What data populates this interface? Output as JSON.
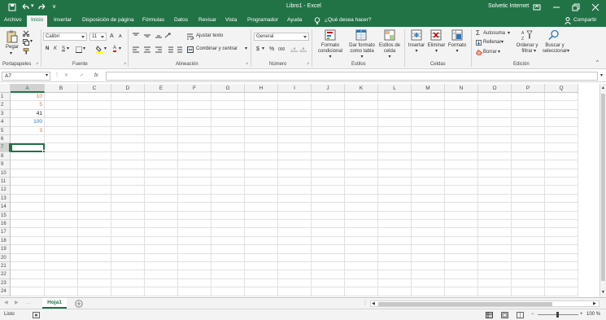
{
  "window": {
    "title": "Libro1 - Excel",
    "user": "Solvetic Internet"
  },
  "quick_access": {
    "customize_label": "∨"
  },
  "tabs": [
    "Archivo",
    "Inicio",
    "Insertar",
    "Disposición de página",
    "Fórmulas",
    "Datos",
    "Revisar",
    "Vista",
    "Programador",
    "Ayuda"
  ],
  "tell_me": "¿Qué desea hacer?",
  "share": "Compartir",
  "ribbon": {
    "portapapeles": {
      "group": "Portapapeles",
      "paste": "Pegar"
    },
    "fuente": {
      "group": "Fuente",
      "font_name": "Calibri",
      "font_size": "11",
      "bold": "N",
      "italic": "K",
      "underline": "S",
      "font_color_letter": "A",
      "grow_letter": "A",
      "shrink_letter": "A"
    },
    "alineacion": {
      "group": "Alineación",
      "wrap": "Ajustar texto",
      "merge": "Combinar y centrar"
    },
    "numero": {
      "group": "Número",
      "format": "General",
      "currency": "$",
      "percent": "%",
      "thousands": "000"
    },
    "estilos": {
      "group": "Estilos",
      "cond_1": "Formato",
      "cond_2": "condicional",
      "table_1": "Dar formato",
      "table_2": "como tabla",
      "cell_1": "Estilos de",
      "cell_2": "celda"
    },
    "celdas": {
      "group": "Celdas",
      "insert": "Insertar",
      "delete": "Eliminar",
      "format": "Formato"
    },
    "edicion": {
      "group": "Edición",
      "autosum": "Autosuma",
      "fill": "Rellenar",
      "clear": "Borrar",
      "sort_1": "Ordenar y",
      "sort_2": "filtrar",
      "find_1": "Buscar y",
      "find_2": "seleccionar"
    }
  },
  "formula_bar": {
    "name_box": "A7",
    "cancel": "✕",
    "enter": "✓",
    "fx": "fx",
    "value": ""
  },
  "columns": [
    "A",
    "B",
    "C",
    "D",
    "E",
    "F",
    "G",
    "H",
    "I",
    "J",
    "K",
    "L",
    "M",
    "N",
    "O",
    "P",
    "Q"
  ],
  "rows": [
    "1",
    "2",
    "3",
    "4",
    "5",
    "6",
    "7",
    "8",
    "9",
    "10",
    "11",
    "12",
    "13",
    "14",
    "15",
    "16",
    "17",
    "18",
    "19",
    "20",
    "21",
    "22",
    "23",
    "24"
  ],
  "cells": [
    {
      "ref": "A1",
      "value": "10",
      "color": "#e07030"
    },
    {
      "ref": "A2",
      "value": "5",
      "color": "#e07030"
    },
    {
      "ref": "A3",
      "value": "41",
      "color": "#222222"
    },
    {
      "ref": "A4",
      "value": "100",
      "color": "#2e75b6"
    },
    {
      "ref": "A5",
      "value": "3",
      "color": "#e07030"
    }
  ],
  "active_cell": "A7",
  "sheets": [
    "Hoja1"
  ],
  "status": {
    "ready": "Listo",
    "zoom": "100 %"
  },
  "colors": {
    "accent": "#217346"
  }
}
